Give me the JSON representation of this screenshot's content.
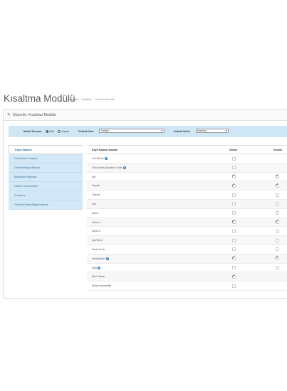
{
  "header": {
    "title": "Kısaltma Modülü",
    "breadcrumb": [
      "Anasayfa",
      "Modüller",
      "Kısaltma Modülü"
    ]
  },
  "panel": {
    "title": "Düzenle: Kısaltma Modülü",
    "icon": "pencil-icon"
  },
  "filters": {
    "status_label": "Modül Durumu:",
    "status_on": "Aktif",
    "status_off": "Kapalı",
    "status_selected": "Aktif",
    "country_label": "Default Ülke:",
    "country_value": "Türkiye",
    "city_label": "Default Şehir:",
    "city_value": "İstanbul"
  },
  "sidebar": {
    "items": [
      {
        "label": "Kayıt Sayfası",
        "active": true
      },
      {
        "label": "Düzenleme Sayfası",
        "active": false
      },
      {
        "label": "Ödeme/Kargo/Misafir",
        "active": false
      },
      {
        "label": "Makaleler/Sayfalar",
        "active": false
      },
      {
        "label": "Ödeme Seçenekleri",
        "active": false
      },
      {
        "label": "Sıralama",
        "active": false
      },
      {
        "label": "Yardım/Destek/Bilgilendirme",
        "active": false
      }
    ]
  },
  "table": {
    "headers": {
      "field": "Kayıt Sayfası Alanları",
      "show": "Göster",
      "required": "Gerekli"
    },
    "rows": [
      {
        "label": "Tek Bölüm",
        "info": true,
        "show": false,
        "required": null
      },
      {
        "label": "Tüm Adres Alanlarını Gizle",
        "info": true,
        "show": false,
        "required": null
      },
      {
        "label": "Adı",
        "info": false,
        "show": true,
        "required": true
      },
      {
        "label": "Soyadı",
        "info": false,
        "show": true,
        "required": true
      },
      {
        "label": "Telefon",
        "info": false,
        "show": false,
        "required": false
      },
      {
        "label": "Fax",
        "info": false,
        "show": false,
        "required": false
      },
      {
        "label": "Şirket",
        "info": false,
        "show": false,
        "required": false
      },
      {
        "label": "Adres 1",
        "info": false,
        "show": true,
        "required": true
      },
      {
        "label": "Adres 2",
        "info": false,
        "show": false,
        "required": false
      },
      {
        "label": "İlçe/Semt",
        "info": false,
        "show": false,
        "required": false
      },
      {
        "label": "Posta Kodu",
        "info": false,
        "show": false,
        "required": false
      },
      {
        "label": "Şehir/İlçeler",
        "info": true,
        "show": true,
        "required": true
      },
      {
        "label": "Ülke",
        "info": true,
        "show": false,
        "required": false
      },
      {
        "label": "Şifre Tekrar",
        "info": false,
        "show": true,
        "required": null
      },
      {
        "label": "Bülten Abonelliği",
        "info": false,
        "show": false,
        "required": null
      }
    ]
  }
}
